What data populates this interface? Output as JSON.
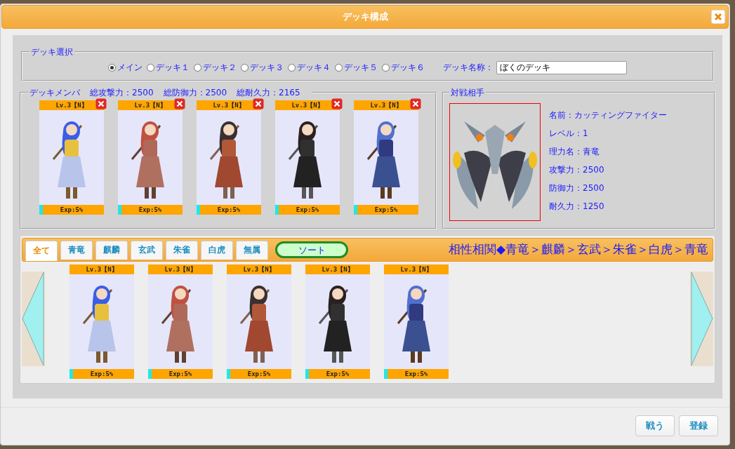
{
  "window": {
    "title": "デッキ構成"
  },
  "deck_select": {
    "legend": "デッキ選択",
    "options": [
      {
        "label": "メイン",
        "selected": true
      },
      {
        "label": "デッキ１",
        "selected": false
      },
      {
        "label": "デッキ２",
        "selected": false
      },
      {
        "label": "デッキ３",
        "selected": false
      },
      {
        "label": "デッキ４",
        "selected": false
      },
      {
        "label": "デッキ５",
        "selected": false
      },
      {
        "label": "デッキ６",
        "selected": false
      }
    ],
    "name_label": "デッキ名称：",
    "name_value": "ぼくのデッキ"
  },
  "members": {
    "legend": "デッキメンバ",
    "totals": [
      "総攻撃力：2500",
      "総防御力：2500",
      "総耐久力：2165"
    ],
    "cards": [
      {
        "rank": "Lv.3【N】",
        "exp": "Exp:5%",
        "level": 0.05
      },
      {
        "rank": "Lv.3【N】",
        "exp": "Exp:5%",
        "level": 0.05
      },
      {
        "rank": "Lv.3【N】",
        "exp": "Exp:5%",
        "level": 0.05
      },
      {
        "rank": "Lv.3【N】",
        "exp": "Exp:5%",
        "level": 0.05
      },
      {
        "rank": "Lv.3【N】",
        "exp": "Exp:5%",
        "level": 0.05
      }
    ]
  },
  "opponent": {
    "legend": "対戦相手",
    "stats": [
      "名前：カッティングファイター",
      "レベル：1",
      "理力名：青竜",
      "攻撃力：2500",
      "防御力：2500",
      "耐久力：1250"
    ]
  },
  "collection": {
    "tabs": [
      {
        "label": "全て",
        "selected": true
      },
      {
        "label": "青竜",
        "selected": false
      },
      {
        "label": "麒麟",
        "selected": false
      },
      {
        "label": "玄武",
        "selected": false
      },
      {
        "label": "朱雀",
        "selected": false
      },
      {
        "label": "白虎",
        "selected": false
      },
      {
        "label": "無属",
        "selected": false
      }
    ],
    "sort_button": "ソート",
    "relation": "相性相関◆青竜＞麒麟＞玄武＞朱雀＞白虎＞青竜",
    "cards": [
      {
        "rank": "Lv.3【N】",
        "exp": "Exp:5%",
        "level": 0.05
      },
      {
        "rank": "Lv.3【N】",
        "exp": "Exp:5%",
        "level": 0.05
      },
      {
        "rank": "Lv.3【N】",
        "exp": "Exp:5%",
        "level": 0.05
      },
      {
        "rank": "Lv.3【N】",
        "exp": "Exp:5%",
        "level": 0.05
      },
      {
        "rank": "Lv.3【N】",
        "exp": "Exp:5%",
        "level": 0.05
      }
    ]
  },
  "buttons": [
    "戦う",
    "登録"
  ]
}
